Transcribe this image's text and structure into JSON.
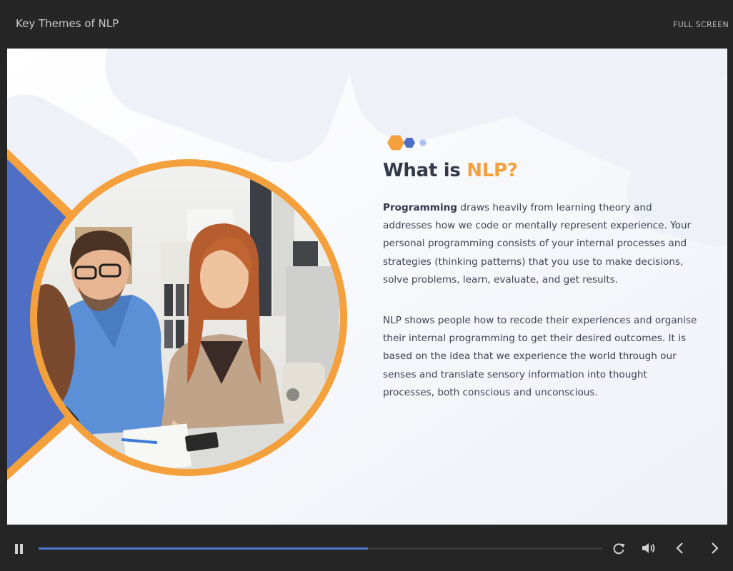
{
  "header": {
    "title": "Key Themes of NLP",
    "fullscreen_label": "FULL SCREEN"
  },
  "slide": {
    "title_prefix": "What is ",
    "title_accent": "NLP?",
    "paragraph1_lead": "Programming",
    "paragraph1_rest": " draws heavily from learning theory and addresses how we code or mentally represent experience. Your personal programming consists of your internal processes and strategies (thinking patterns) that you use to make decisions, solve problems, learn, evaluate, and get results.",
    "paragraph2": "NLP shows people how to recode their experiences and organise their internal programming to get their desired outcomes. It is based on the idea that we experience the world through our senses and translate sensory information into thought processes, both conscious and unconscious."
  },
  "controls": {
    "progress": 0.584,
    "icons": [
      "pause-icon",
      "replay-icon",
      "volume-icon",
      "chevron-left-icon",
      "chevron-right-icon"
    ]
  },
  "colors": {
    "accent": "#f4a03c",
    "brand_blue": "#4f6fc4",
    "light_blue": "#a9c0f2",
    "text_dark": "#33394a",
    "progress": "#4d7bd0"
  }
}
